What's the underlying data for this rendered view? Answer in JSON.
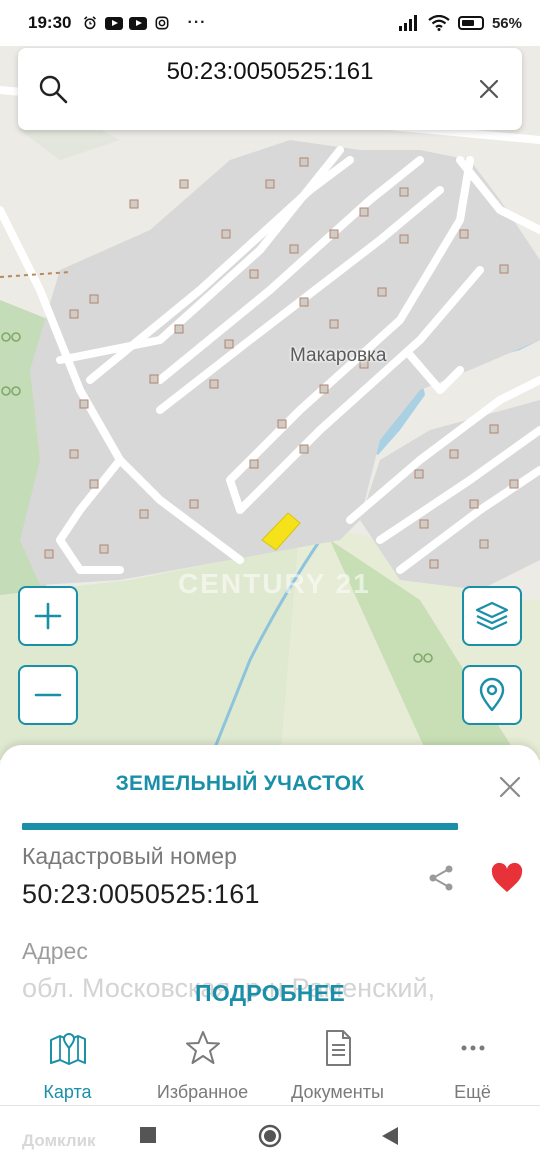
{
  "status_bar": {
    "time": "19:30",
    "battery": "56%"
  },
  "search": {
    "query": "50:23:0050525:161"
  },
  "map": {
    "place_label": "Макаровка",
    "watermark": "CENTURY 21"
  },
  "sheet": {
    "title": "ЗЕМЕЛЬНЫЙ УЧАСТОК",
    "cadastral_label": "Кадастровый номер",
    "cadastral_value": "50:23:0050525:161",
    "address_label": "Адрес",
    "address_faded": "обл. Московская, р-н Раменский,",
    "more_button": "ПОДРОБНЕЕ",
    "favorite": true
  },
  "nav": {
    "items": [
      {
        "label": "Карта",
        "icon": "map-icon",
        "active": true
      },
      {
        "label": "Избранное",
        "icon": "star-icon",
        "active": false
      },
      {
        "label": "Документы",
        "icon": "document-icon",
        "active": false
      },
      {
        "label": "Ещё",
        "icon": "more-icon",
        "active": false
      }
    ]
  },
  "system_nav": {
    "watermark": "Домклик"
  },
  "colors": {
    "accent": "#1a8fa8",
    "heart": "#e8323a",
    "selection": "#f5e21a"
  }
}
